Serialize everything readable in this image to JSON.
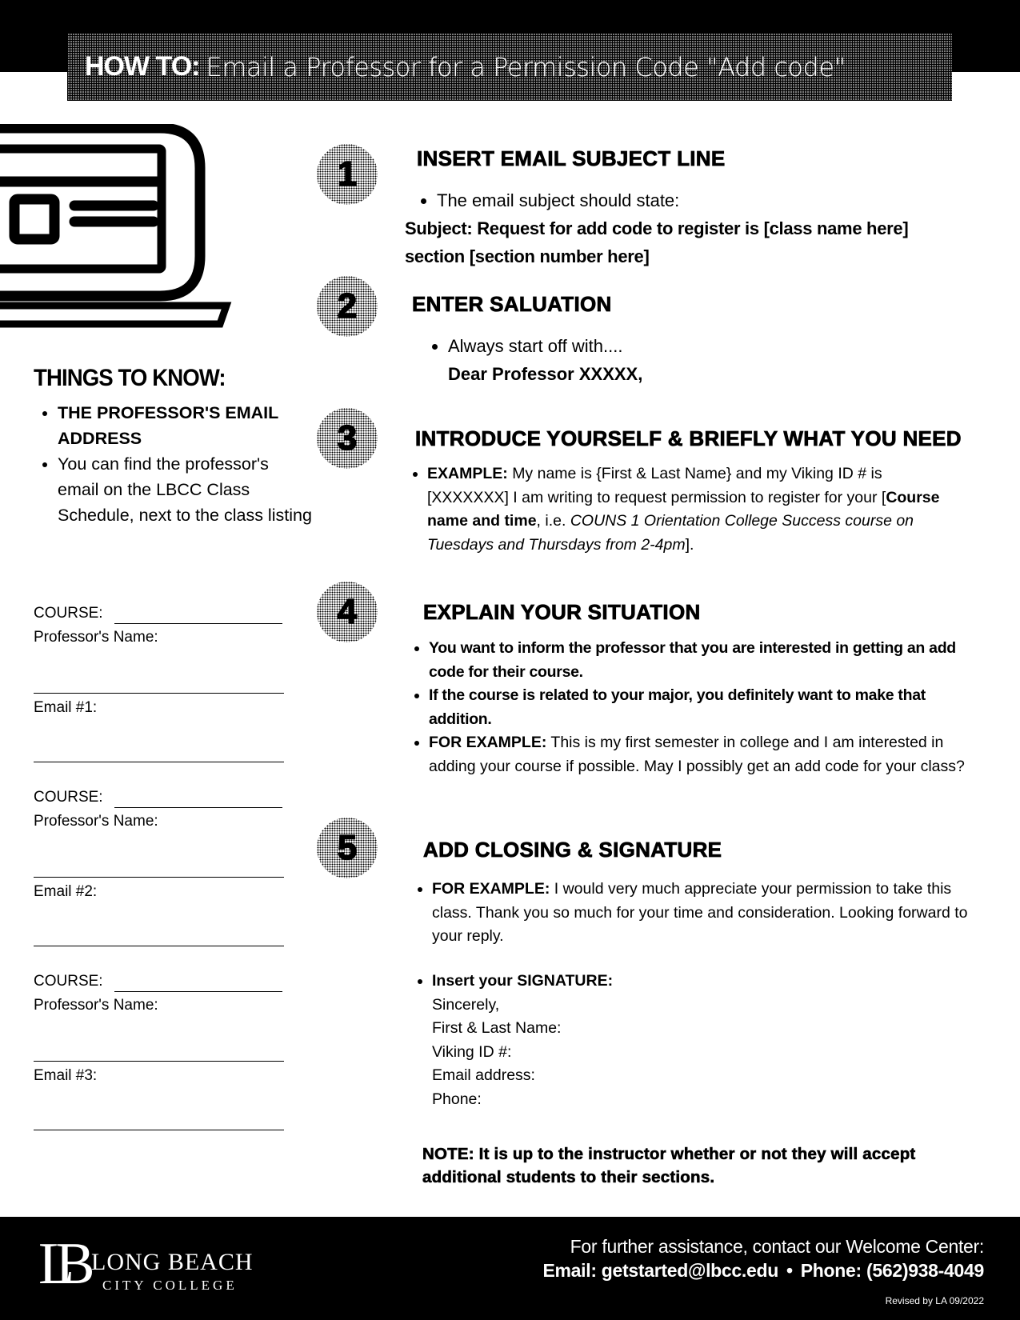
{
  "header": {
    "title_bold": "HOW TO:",
    "title_rest": "Email a Professor for a Permission Code \"Add code\""
  },
  "illustration": {
    "icon": "laptop-icon"
  },
  "things_to_know": {
    "title": "THINGS TO KNOW:",
    "items": [
      "THE PROFESSOR'S EMAIL ADDRESS",
      "You can find the professor's email on the LBCC Class Schedule, next to the class listing"
    ]
  },
  "form": {
    "blocks": [
      {
        "course_label": "COURSE:",
        "professor_label": "Professor's Name:",
        "email_label": "Email #1:"
      },
      {
        "course_label": "COURSE:",
        "professor_label": "Professor's Name:",
        "email_label": "Email #2:"
      },
      {
        "course_label": "COURSE:",
        "professor_label": "Professor's Name:",
        "email_label": "Email #3:"
      }
    ]
  },
  "steps": [
    {
      "number": "1",
      "heading": "INSERT EMAIL SUBJECT LINE",
      "bullet": "The email subject should state:",
      "subject_line_1": "Subject: Request for add code to register is [class name here]",
      "subject_line_2": "section [section number here]"
    },
    {
      "number": "2",
      "heading": "ENTER SALUATION",
      "bullet": "Always start off with....",
      "salutation": "Dear Professor XXXXX,"
    },
    {
      "number": "3",
      "heading": "INTRODUCE YOURSELF & BRIEFLY WHAT YOU NEED",
      "example_label": "EXAMPLE:",
      "example_text_1": "My name is {First & Last Name} and my Viking ID # is [XXXXXXX]  I am writing to request permission to register for your [",
      "example_bold": "Course name and time",
      "example_text_2": ", i.e. ",
      "example_italic": "COUNS 1 Orientation College Success course on Tuesdays and Thursdays from 2-4pm",
      "example_text_3": "]."
    },
    {
      "number": "4",
      "heading": "EXPLAIN YOUR SITUATION",
      "bullets": [
        "You want to inform the professor that you are interested in getting an add code for their course.",
        "If the course is related to your major, you definitely want to make that addition."
      ],
      "example_label": "FOR EXAMPLE:",
      "example_text": "This is my first semester in college and I am interested in adding your course if possible. May I possibly get an add code for your class?"
    },
    {
      "number": "5",
      "heading": "ADD CLOSING & SIGNATURE",
      "example_label": "FOR EXAMPLE:",
      "example_text": "I would very much appreciate your permission to take this class. Thank you so much for your time and consideration.  Looking forward to your reply.",
      "signature_label": "Insert your SIGNATURE:",
      "signature_lines": [
        "Sincerely,",
        "First & Last Name:",
        "Viking ID #:",
        "Email address:",
        "Phone:"
      ]
    }
  ],
  "note": "NOTE: It is up to the instructor whether or not they will accept additional students to their sections.",
  "footer": {
    "logo_monogram": "LB",
    "logo_name": "LONG BEACH",
    "logo_sub": "CITY COLLEGE",
    "contact_intro": "For further assistance, contact our Welcome Center:",
    "email": "Email: getstarted@lbcc.edu",
    "separator": "•",
    "phone": "Phone: (562)938-4049",
    "revised": "Revised by LA 09/2022"
  }
}
